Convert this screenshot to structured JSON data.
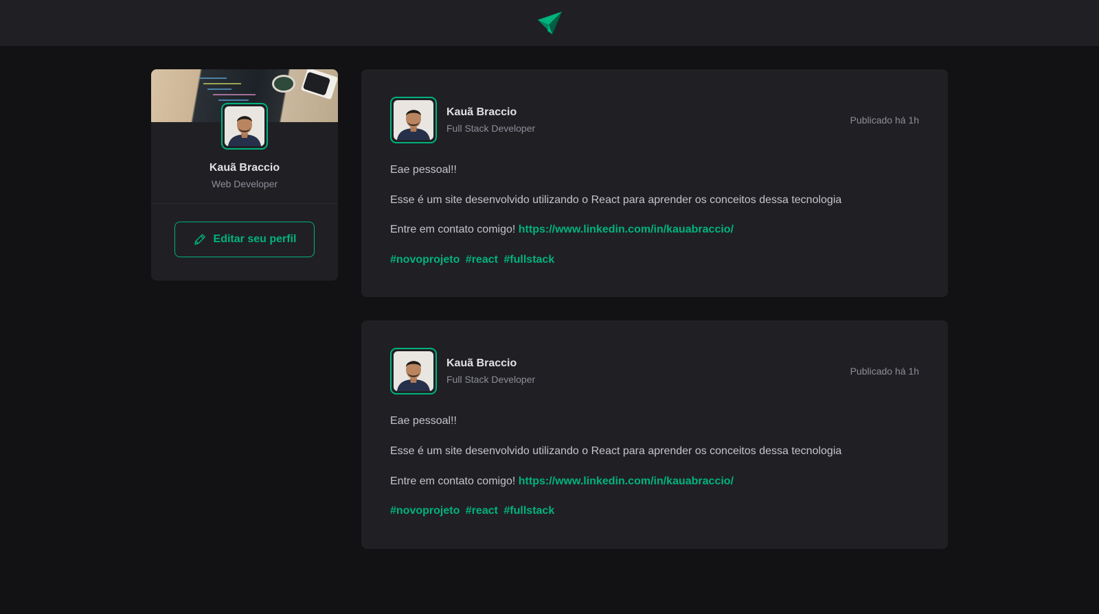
{
  "header": {
    "logo_icon": "paper-plane-icon",
    "accent": "#00b37e"
  },
  "sidebar": {
    "name": "Kauã Braccio",
    "role": "Web Developer",
    "cover_icon": "desk-cover-image",
    "avatar_icon": "user-avatar",
    "edit_button": {
      "label": "Editar seu perfil",
      "icon": "pencil-icon"
    }
  },
  "posts": [
    {
      "author_name": "Kauã Braccio",
      "author_role": "Full Stack Developer",
      "published": "Publicado há 1h",
      "greeting": "Eae pessoal!!",
      "body": "Esse é um site desenvolvido utilizando o React para aprender os conceitos dessa tecnologia",
      "contact_prefix": "Entre em contato comigo!",
      "link": "https://www.linkedin.com/in/kauabraccio/",
      "hashtags": [
        "#novoprojeto",
        "#react",
        "#fullstack"
      ]
    },
    {
      "author_name": "Kauã Braccio",
      "author_role": "Full Stack Developer",
      "published": "Publicado há 1h",
      "greeting": "Eae pessoal!!",
      "body": "Esse é um site desenvolvido utilizando o React para aprender os conceitos dessa tecnologia",
      "contact_prefix": "Entre em contato comigo!",
      "link": "https://www.linkedin.com/in/kauabraccio/",
      "hashtags": [
        "#novoprojeto",
        "#react",
        "#fullstack"
      ]
    }
  ],
  "colors": {
    "background": "#121214",
    "surface": "#202024",
    "accent": "#00b37e",
    "text_muted": "#8d8d99"
  }
}
